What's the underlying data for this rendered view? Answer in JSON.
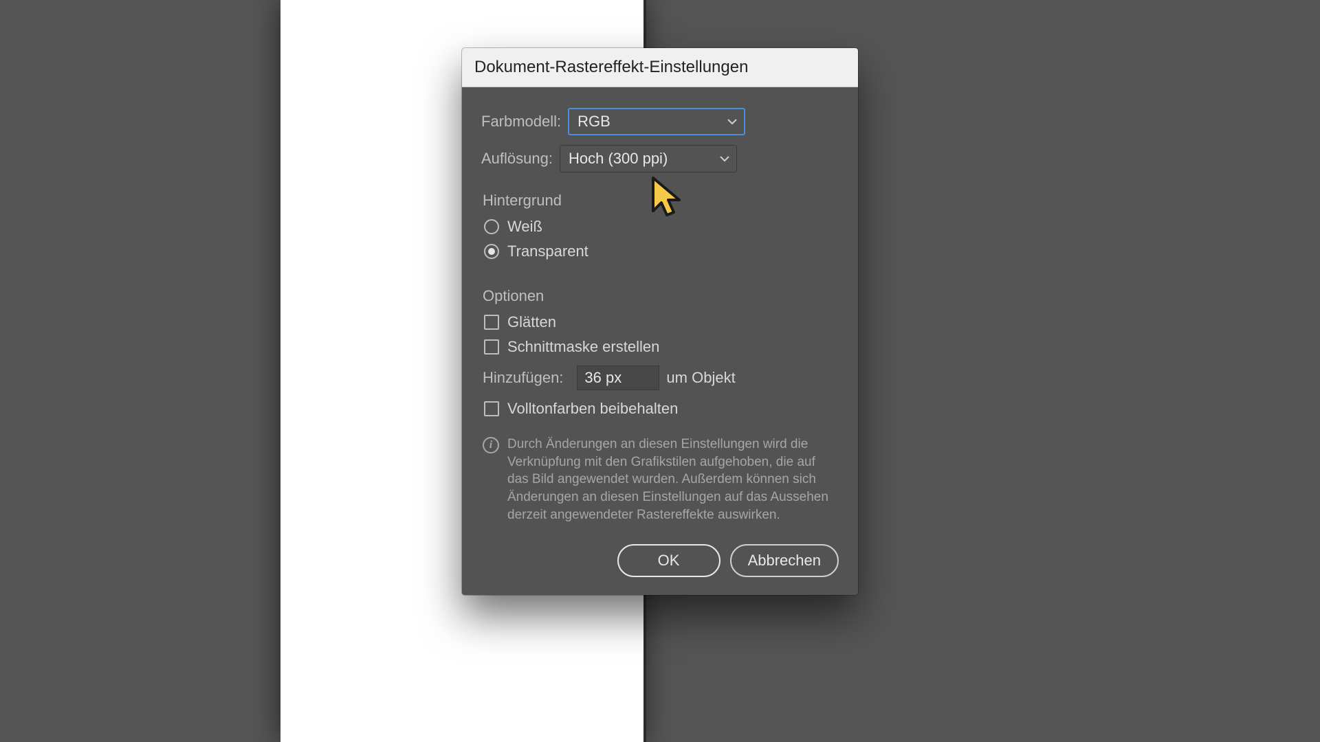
{
  "dialog": {
    "title": "Dokument-Rastereffekt-Einstellungen",
    "fields": {
      "colorModel": {
        "label": "Farbmodell:",
        "value": "RGB"
      },
      "resolution": {
        "label": "Auflösung:",
        "value": "Hoch (300 ppi)"
      }
    },
    "background": {
      "groupLabel": "Hintergrund",
      "white": "Weiß",
      "transparent": "Transparent",
      "selected": "transparent"
    },
    "options": {
      "groupLabel": "Optionen",
      "antialias": "Glätten",
      "clipMask": "Schnittmaske erstellen",
      "add": {
        "label": "Hinzufügen:",
        "value": "36 px",
        "suffix": "um Objekt"
      },
      "preserveSpot": "Volltonfarben beibehalten"
    },
    "info": "Durch Änderungen an diesen Einstellungen wird die Verknüpfung mit den Grafikstilen aufgehoben, die auf das Bild angewendet wurden. Außerdem können sich Änderungen an diesen Einstellungen auf das Aussehen derzeit angewendeter Rastereffekte auswirken.",
    "buttons": {
      "ok": "OK",
      "cancel": "Abbrechen"
    }
  }
}
